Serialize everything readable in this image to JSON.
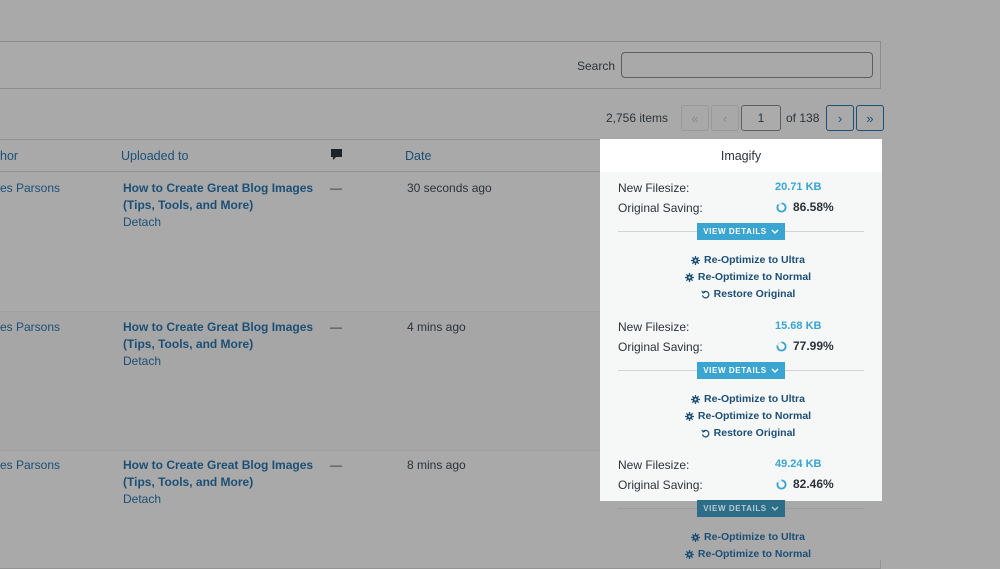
{
  "search": {
    "label": "Search",
    "value": ""
  },
  "pagination": {
    "items_count": "2,756 items",
    "first_label": "«",
    "prev_label": "‹",
    "current_page": "1",
    "of_label": "of 138",
    "next_label": "›",
    "last_label": "»"
  },
  "columns": {
    "author": "hor",
    "uploaded_to": "Uploaded to",
    "date": "Date",
    "imagify": "Imagify"
  },
  "rows": [
    {
      "author": "es Parsons",
      "uploaded_line1": "How to Create Great Blog Images",
      "uploaded_line2": "(Tips, Tools, and More)",
      "detach": "Detach",
      "comments": "—",
      "date": "30 seconds ago",
      "new_filesize_label": "New Filesize:",
      "new_filesize": "20.71 KB",
      "original_saving_label": "Original Saving:",
      "original_saving": "86.58%",
      "saving_fraction": 0.8658,
      "view_details": "VIEW DETAILS",
      "reoptimize_ultra": "Re-Optimize to Ultra",
      "reoptimize_normal": "Re-Optimize to Normal",
      "restore_original": "Restore Original"
    },
    {
      "author": "es Parsons",
      "uploaded_line1": "How to Create Great Blog Images",
      "uploaded_line2": "(Tips, Tools, and More)",
      "detach": "Detach",
      "comments": "—",
      "date": "4 mins ago",
      "new_filesize_label": "New Filesize:",
      "new_filesize": "15.68 KB",
      "original_saving_label": "Original Saving:",
      "original_saving": "77.99%",
      "saving_fraction": 0.7799,
      "view_details": "VIEW DETAILS",
      "reoptimize_ultra": "Re-Optimize to Ultra",
      "reoptimize_normal": "Re-Optimize to Normal",
      "restore_original": "Restore Original"
    },
    {
      "author": "es Parsons",
      "uploaded_line1": "How to Create Great Blog Images",
      "uploaded_line2": "(Tips, Tools, and More)",
      "detach": "Detach",
      "comments": "—",
      "date": "8 mins ago",
      "new_filesize_label": "New Filesize:",
      "new_filesize": "49.24 KB",
      "original_saving_label": "Original Saving:",
      "original_saving": "82.46%",
      "saving_fraction": 0.8246,
      "view_details": "VIEW DETAILS",
      "reoptimize_ultra": "Re-Optimize to Ultra",
      "reoptimize_normal": "Re-Optimize to Normal"
    }
  ],
  "colors": {
    "accent": "#3aa5d1",
    "link": "#1c4f76",
    "overlay_bg": "#a9a9a9",
    "panel_bg": "#f6f7f7"
  }
}
